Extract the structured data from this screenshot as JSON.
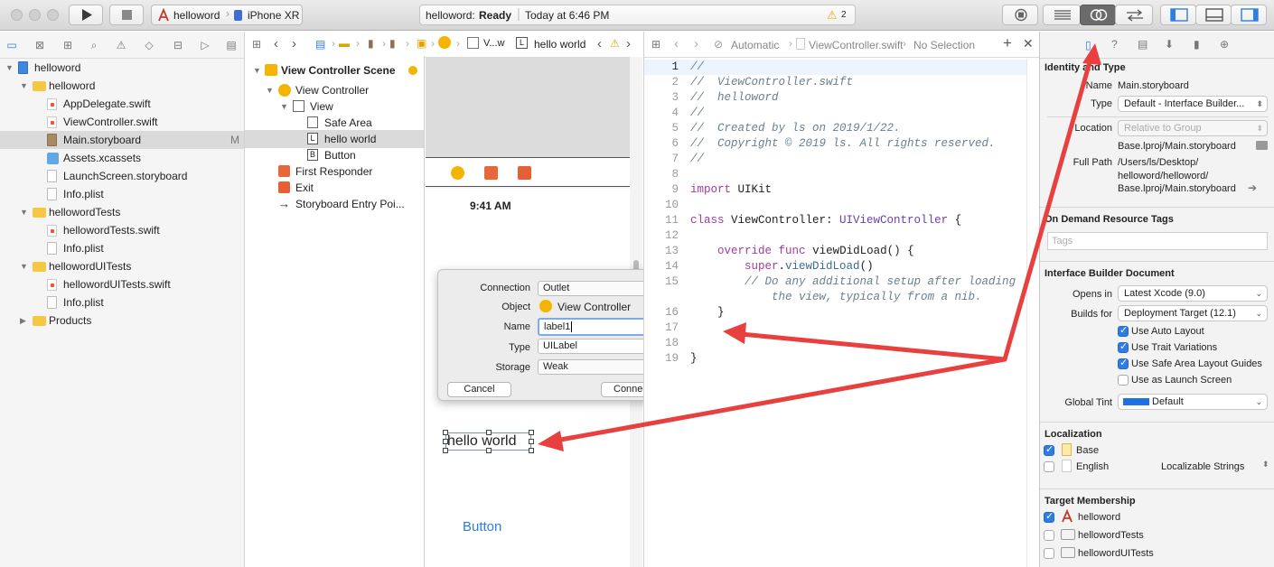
{
  "toolbar": {
    "scheme": "helloword",
    "device": "iPhone XR",
    "status_project": "helloword:",
    "status_state": "Ready",
    "status_time": "Today at 6:46 PM",
    "warning_count": "2"
  },
  "navigator": {
    "items": [
      {
        "label": "helloword",
        "kind": "project",
        "depth": 0,
        "expanded": true
      },
      {
        "label": "helloword",
        "kind": "folder",
        "depth": 1,
        "expanded": true
      },
      {
        "label": "AppDelegate.swift",
        "kind": "swift",
        "depth": 2
      },
      {
        "label": "ViewController.swift",
        "kind": "swift",
        "depth": 2
      },
      {
        "label": "Main.storyboard",
        "kind": "storyboard",
        "depth": 2,
        "badge": "M",
        "selected": true
      },
      {
        "label": "Assets.xcassets",
        "kind": "assets",
        "depth": 2
      },
      {
        "label": "LaunchScreen.storyboard",
        "kind": "file",
        "depth": 2
      },
      {
        "label": "Info.plist",
        "kind": "file",
        "depth": 2
      },
      {
        "label": "hellowordTests",
        "kind": "folder",
        "depth": 1,
        "expanded": true
      },
      {
        "label": "hellowordTests.swift",
        "kind": "swift",
        "depth": 2
      },
      {
        "label": "Info.plist",
        "kind": "file",
        "depth": 2
      },
      {
        "label": "hellowordUITests",
        "kind": "folder",
        "depth": 1,
        "expanded": true
      },
      {
        "label": "hellowordUITests.swift",
        "kind": "swift",
        "depth": 2
      },
      {
        "label": "Info.plist",
        "kind": "file",
        "depth": 2
      },
      {
        "label": "Products",
        "kind": "folder",
        "depth": 1,
        "expanded": false
      }
    ]
  },
  "jumpbar": {
    "crumb_short": "V...w",
    "current": "hello world"
  },
  "outline": {
    "scene": "View Controller Scene",
    "items": [
      {
        "label": "View Controller",
        "depth": 1
      },
      {
        "label": "View",
        "depth": 2
      },
      {
        "label": "Safe Area",
        "depth": 3
      },
      {
        "label": "hello world",
        "depth": 3,
        "selected": true
      },
      {
        "label": "Button",
        "depth": 3
      },
      {
        "label": "First Responder",
        "depth": 1
      },
      {
        "label": "Exit",
        "depth": 1
      },
      {
        "label": "Storyboard Entry Poi...",
        "depth": 1
      }
    ]
  },
  "canvas": {
    "time": "9:41 AM",
    "label_text": "hello world",
    "button_text": "Button"
  },
  "popover": {
    "connection_label": "Connection",
    "connection_value": "Outlet",
    "object_label": "Object",
    "object_value": "View Controller",
    "name_label": "Name",
    "name_value": "label1",
    "type_label": "Type",
    "type_value": "UILabel",
    "storage_label": "Storage",
    "storage_value": "Weak",
    "cancel": "Cancel",
    "connect": "Connect"
  },
  "editor": {
    "mode": "Automatic",
    "file": "ViewController.swift",
    "selection": "No Selection",
    "lines": [
      {
        "n": "1",
        "html": "<span class='c'>//</span>"
      },
      {
        "n": "2",
        "html": "<span class='c'>//  ViewController.swift</span>"
      },
      {
        "n": "3",
        "html": "<span class='c'>//  helloword</span>"
      },
      {
        "n": "4",
        "html": "<span class='c'>//</span>"
      },
      {
        "n": "5",
        "html": "<span class='c'>//  Created by ls on 2019/1/22.</span>"
      },
      {
        "n": "6",
        "html": "<span class='c'>//  Copyright © 2019 ls. All rights reserved.</span>"
      },
      {
        "n": "7",
        "html": "<span class='c'>//</span>"
      },
      {
        "n": "8",
        "html": ""
      },
      {
        "n": "9",
        "html": "<span class='kw'>import</span> UIKit"
      },
      {
        "n": "10",
        "html": ""
      },
      {
        "n": "11",
        "html": "<span class='kw'>class</span> ViewController: <span class='ty'>UIViewController</span> {"
      },
      {
        "n": "12",
        "html": ""
      },
      {
        "n": "13",
        "html": "    <span class='kw'>override</span> <span class='kw'>func</span> viewDidLoad() {"
      },
      {
        "n": "14",
        "html": "        <span class='kw'>super</span>.<span class='fn'>viewDidLoad</span>()"
      },
      {
        "n": "15",
        "html": "        <span class='c'>// Do any additional setup after loading</span>"
      },
      {
        "n": "",
        "html": "            <span class='c'>the view, typically from a nib.</span>"
      },
      {
        "n": "16",
        "html": "    }"
      },
      {
        "n": "17",
        "html": ""
      },
      {
        "n": "18",
        "html": ""
      },
      {
        "n": "19",
        "html": "}"
      }
    ]
  },
  "inspector": {
    "identity_title": "Identity and Type",
    "name_label": "Name",
    "name_value": "Main.storyboard",
    "type_label": "Type",
    "type_value": "Default - Interface Builder...",
    "location_label": "Location",
    "location_value": "Relative to Group",
    "location_path": "Base.lproj/Main.storyboard",
    "fullpath_label": "Full Path",
    "fullpath_1": "/Users/ls/Desktop/",
    "fullpath_2": "helloword/helloword/",
    "fullpath_3": "Base.lproj/Main.storyboard",
    "odr_title": "On Demand Resource Tags",
    "tags_placeholder": "Tags",
    "ibdoc_title": "Interface Builder Document",
    "opens_label": "Opens in",
    "opens_value": "Latest Xcode (9.0)",
    "builds_label": "Builds for",
    "builds_value": "Deployment Target (12.1)",
    "opt_autolayout": "Use Auto Layout",
    "opt_trait": "Use Trait Variations",
    "opt_safearea": "Use Safe Area Layout Guides",
    "opt_launch": "Use as Launch Screen",
    "tint_label": "Global Tint",
    "tint_value": "Default",
    "tint_color": "#1f6fe5",
    "loc_title": "Localization",
    "loc_base": "Base",
    "loc_english": "English",
    "loc_english_value": "Localizable Strings",
    "target_title": "Target Membership",
    "target_1": "helloword",
    "target_2": "hellowordTests",
    "target_3": "hellowordUITests"
  },
  "colors": {
    "arrow": "#e8403e",
    "accent": "#2e7de6",
    "button_blue": "#2f7cdc"
  }
}
